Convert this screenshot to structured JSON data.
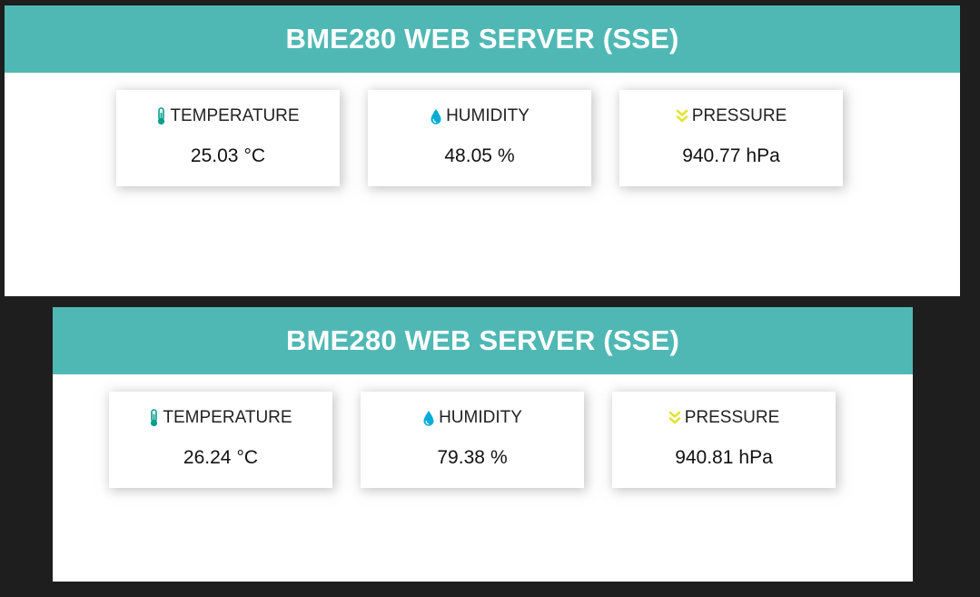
{
  "panels": [
    {
      "title": "BME280 WEB SERVER (SSE)",
      "cards": {
        "temperature": {
          "label": "TEMPERATURE",
          "value": "25.03",
          "unit": "°C"
        },
        "humidity": {
          "label": "HUMIDITY",
          "value": "48.05",
          "unit": "%"
        },
        "pressure": {
          "label": "PRESSURE",
          "value": "940.77",
          "unit": "hPa"
        }
      }
    },
    {
      "title": "BME280 WEB SERVER (SSE)",
      "cards": {
        "temperature": {
          "label": "TEMPERATURE",
          "value": "26.24",
          "unit": "°C"
        },
        "humidity": {
          "label": "HUMIDITY",
          "value": "79.38",
          "unit": "%"
        },
        "pressure": {
          "label": "PRESSURE",
          "value": "940.81",
          "unit": "hPa"
        }
      }
    }
  ],
  "icons": {
    "temperature": "thermometer-icon",
    "humidity": "water-drop-icon",
    "pressure": "double-chevron-down-icon"
  },
  "colors": {
    "topnav_background": "#50b8b4",
    "header_text": "#ffffff",
    "temperature_icon": "#059e8a",
    "humidity_icon": "#00add6",
    "pressure_icon": "#e1e437",
    "page_background": "#1e1e1e"
  }
}
